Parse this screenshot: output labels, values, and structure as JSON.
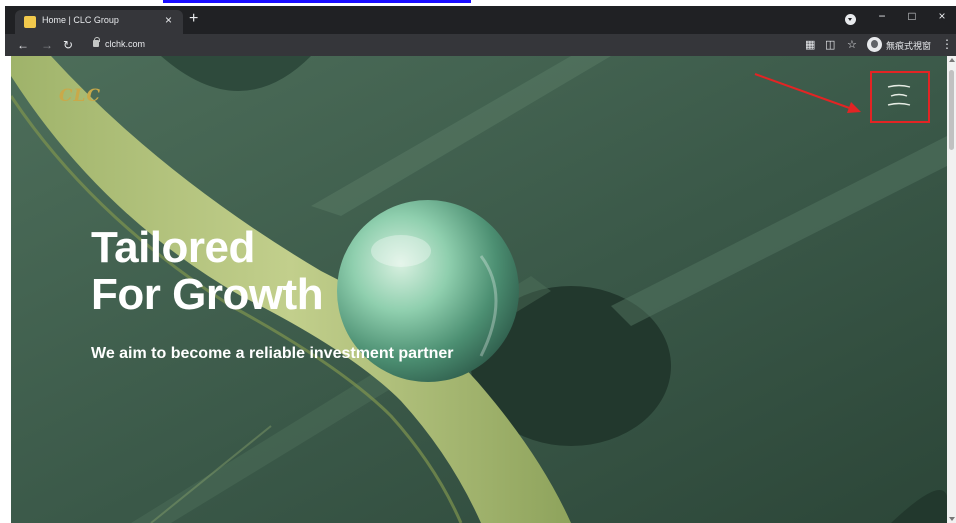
{
  "browser": {
    "tab_title": "Home | CLC Group",
    "tab_close": "×",
    "new_tab": "+",
    "url": "clchk.com",
    "profile_label": "無痕式視窗",
    "minimize": "−",
    "maximize": "□",
    "close": "×",
    "menu_glyph": "⋮"
  },
  "page": {
    "logo": "CLC",
    "hero_title_line1": "Tailored",
    "hero_title_line2": "For Growth",
    "hero_subtitle": "We aim to become a reliable investment partner"
  },
  "icons": {
    "back": "arrow-left-icon",
    "forward": "arrow-right-icon",
    "reload": "reload-icon",
    "lock": "lock-icon",
    "qr": "qr-code-icon",
    "translate": "translate-icon",
    "star": "star-icon",
    "menu": "hamburger-menu-icon"
  },
  "colors": {
    "chrome_dark": "#202124",
    "toolbar": "#35363a",
    "hero_bg": "#3c5b4b",
    "track": "#b6c47f",
    "annotation_red": "#e32424",
    "logo_gold": "#c9a94a"
  }
}
